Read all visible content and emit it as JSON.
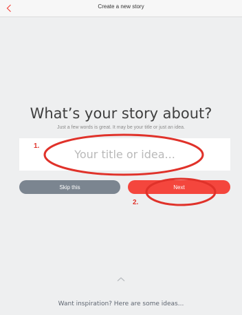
{
  "header": {
    "title": "Create a new story",
    "back_icon": "chevron-left-icon",
    "accent_color": "#f4463d"
  },
  "main": {
    "heading": "What’s your story about?",
    "subtext": "Just a few words is great. It may be your title or just an idea.",
    "input": {
      "value": "",
      "placeholder": "Your title or idea..."
    },
    "skip_label": "Skip this",
    "next_label": "Next"
  },
  "annotations": {
    "marker_1": "1.",
    "marker_2": "2.",
    "color": "#e0322a"
  },
  "footer": {
    "expand_icon": "chevron-up-icon",
    "inspiration_label": "Want inspiration? Here are some ideas..."
  }
}
